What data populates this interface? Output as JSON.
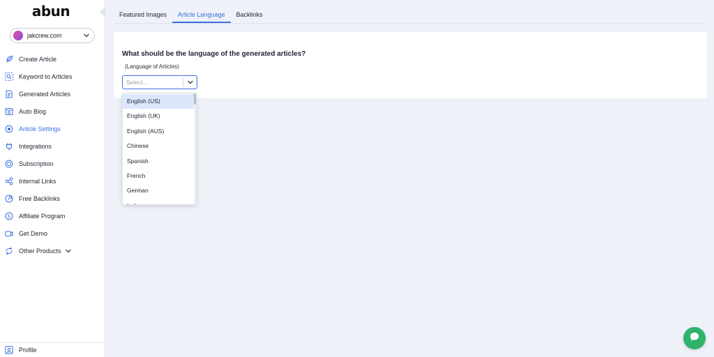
{
  "brand": {
    "logo_text": "abun"
  },
  "site_selector": {
    "value": "jakcrew.com"
  },
  "sidebar": {
    "items": [
      {
        "label": "Create Article",
        "icon": "feather-icon"
      },
      {
        "label": "Keyword to Articles",
        "icon": "keyword-search-icon"
      },
      {
        "label": "Generated Articles",
        "icon": "document-icon"
      },
      {
        "label": "Auto Blog",
        "icon": "auto-blog-icon"
      },
      {
        "label": "Article Settings",
        "icon": "settings-icon",
        "active": true
      },
      {
        "label": "Integrations",
        "icon": "plug-icon"
      },
      {
        "label": "Subscription",
        "icon": "subscription-icon"
      },
      {
        "label": "Internal Links",
        "icon": "link-nodes-icon"
      },
      {
        "label": "Free Backlinks",
        "icon": "backlink-icon"
      },
      {
        "label": "Affiliate Program",
        "icon": "dollar-icon"
      },
      {
        "label": "Get Demo",
        "icon": "video-icon"
      },
      {
        "label": "Other Products",
        "icon": "refresh-arrows-icon"
      }
    ],
    "profile_label": "Profile"
  },
  "tabs": [
    {
      "label": "Featured Images",
      "active": false
    },
    {
      "label": "Article Language",
      "active": true
    },
    {
      "label": "Backlinks",
      "active": false
    }
  ],
  "language_card": {
    "question": "What should be the language of the generated articles?",
    "sublabel": "(Language of Articles)",
    "select_placeholder": "Select..."
  },
  "dropdown": {
    "options": [
      "English (US)",
      "English (UK)",
      "English (AUS)",
      "Chinese",
      "Spanish",
      "French",
      "German",
      "Italian"
    ],
    "highlighted": "English (US)"
  },
  "colors": {
    "accent": "#3b6fe0",
    "background": "#eef1f8",
    "chat_button": "#2fb36b",
    "option_highlight": "#dbe7fb"
  }
}
